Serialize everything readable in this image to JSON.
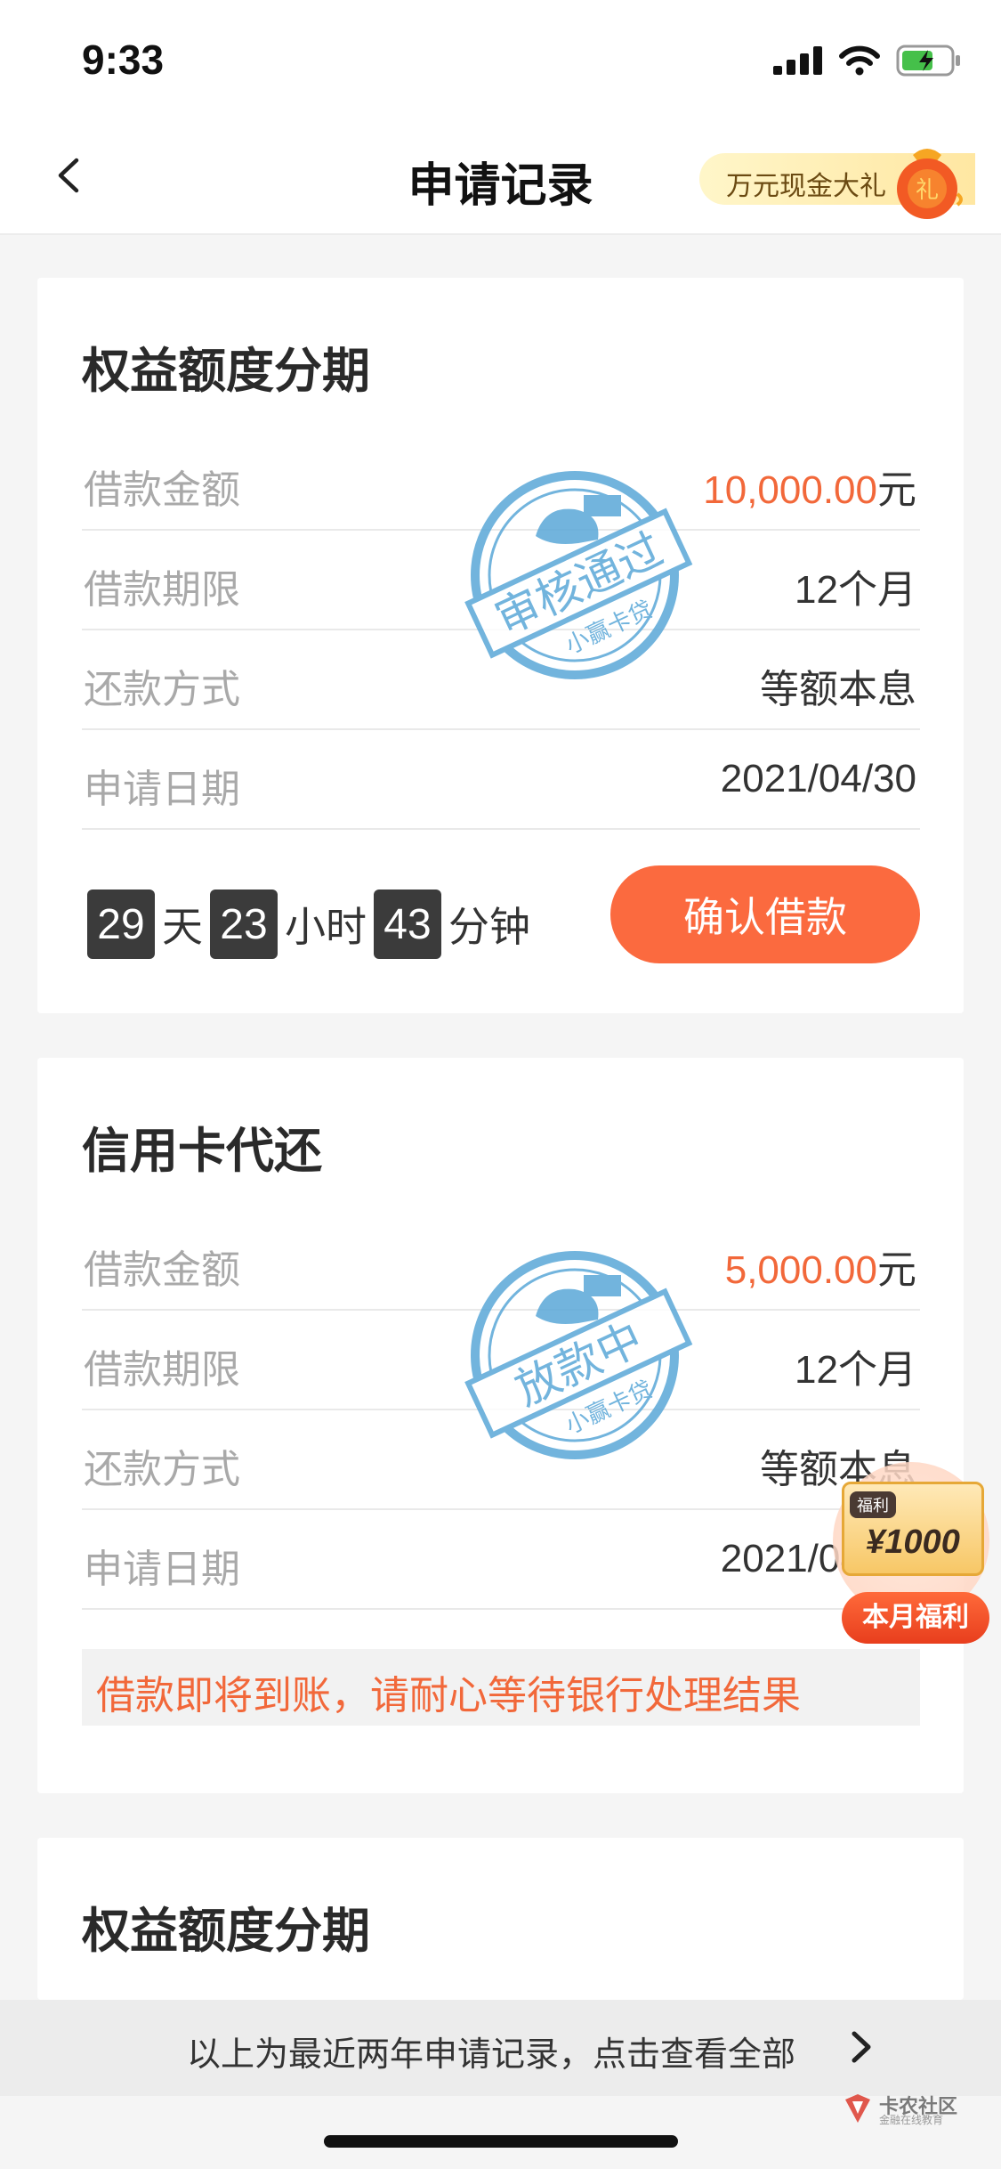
{
  "status_bar": {
    "time": "9:33"
  },
  "nav": {
    "title": "申请记录",
    "promo_label": "万元现金大礼",
    "gift_char": "礼"
  },
  "records": [
    {
      "title": "权益额度分期",
      "rows": [
        {
          "label": "借款金额",
          "amount": "10,000.00",
          "unit": "元"
        },
        {
          "label": "借款期限",
          "value": "12个月"
        },
        {
          "label": "还款方式",
          "value": "等额本息"
        },
        {
          "label": "申请日期",
          "value": "2021/04/30"
        }
      ],
      "stamp": {
        "text": "审核通过",
        "brand": "小赢卡贷"
      },
      "countdown": {
        "days": "29",
        "days_unit": "天",
        "hours": "23",
        "hours_unit": "小时",
        "minutes": "43",
        "minutes_unit": "分钟"
      },
      "action_label": "确认借款"
    },
    {
      "title": "信用卡代还",
      "rows": [
        {
          "label": "借款金额",
          "amount": "5,000.00",
          "unit": "元"
        },
        {
          "label": "借款期限",
          "value": "12个月"
        },
        {
          "label": "还款方式",
          "value": "等额本息"
        },
        {
          "label": "申请日期",
          "value": "2021/04/30"
        }
      ],
      "stamp": {
        "text": "放款中",
        "brand": "小赢卡贷"
      },
      "notice": "借款即将到账，请耐心等待银行处理结果"
    },
    {
      "title": "权益额度分期"
    }
  ],
  "welfare": {
    "tag": "福利",
    "amount": "¥1000",
    "label": "本月福利"
  },
  "bottom": {
    "text": "以上为最近两年申请记录，点击查看全部"
  },
  "watermark": {
    "main": "卡农社区",
    "sub": "金融在线教育"
  },
  "colors": {
    "accent": "#fb6a3f",
    "amount": "#f2683a",
    "stamp": "#5aa8d8"
  }
}
